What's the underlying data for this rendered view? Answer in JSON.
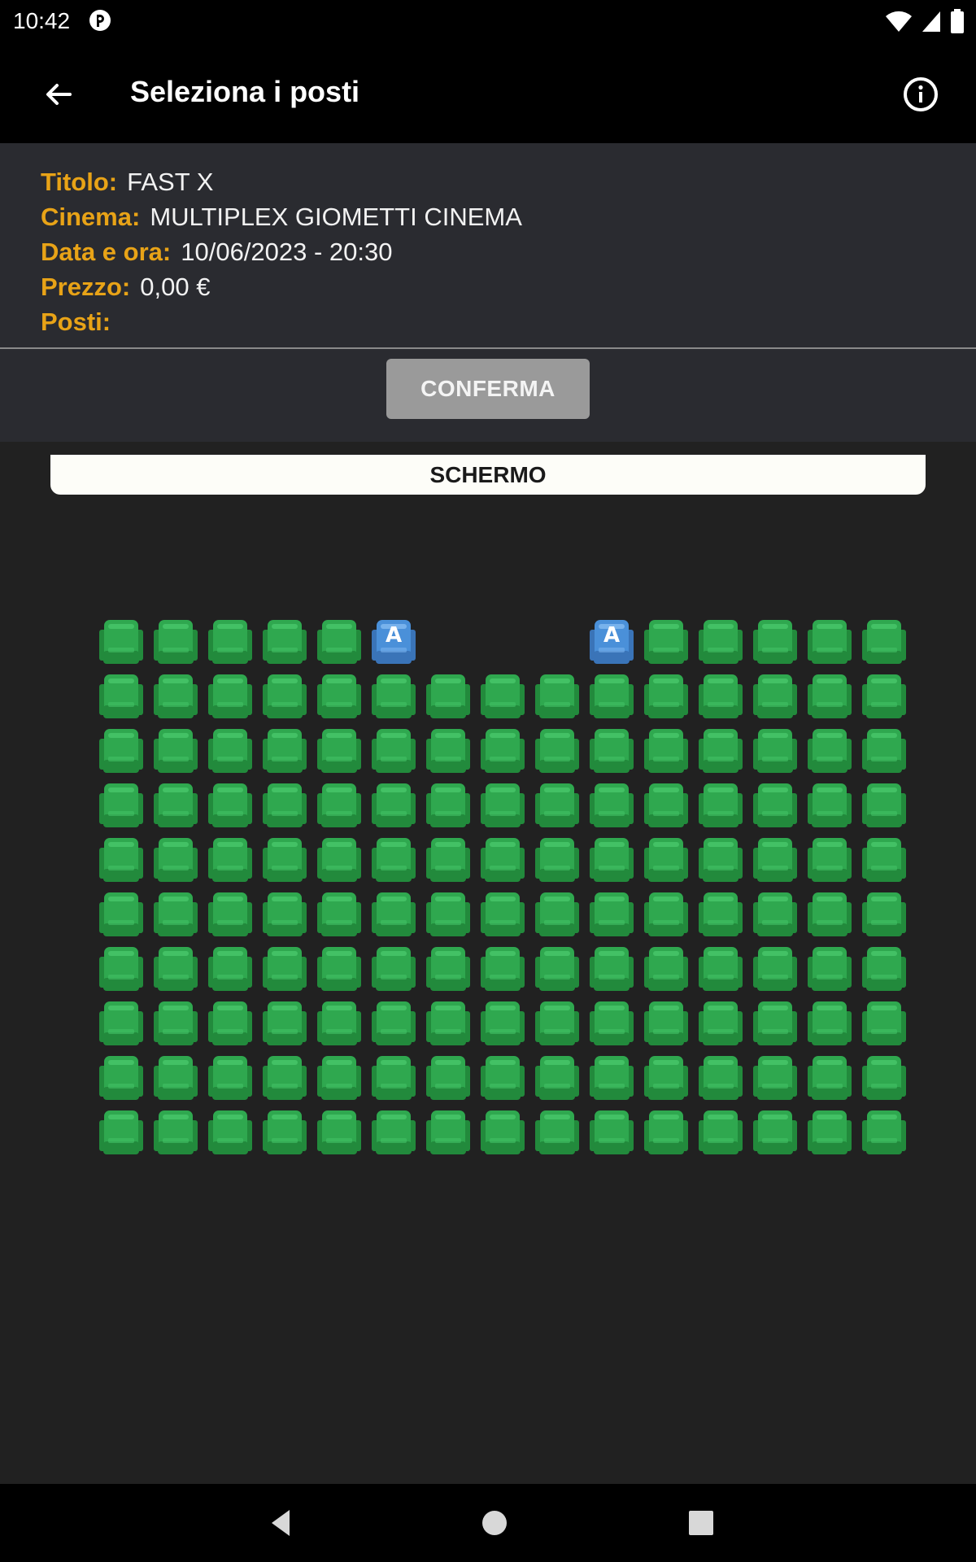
{
  "status_bar": {
    "time": "10:42",
    "icons": [
      "app-notification-icon",
      "wifi-icon",
      "cellular-signal-icon",
      "battery-icon"
    ]
  },
  "app_bar": {
    "title": "Seleziona i posti",
    "back_icon": "arrow-left-icon",
    "info_icon": "info-circle-icon"
  },
  "details": {
    "title_label": "Titolo:",
    "title_value": "FAST X",
    "cinema_label": "Cinema:",
    "cinema_value": "MULTIPLEX GIOMETTI CINEMA",
    "datetime_label": "Data e ora:",
    "datetime_value": "10/06/2023 - 20:30",
    "price_label": "Prezzo:",
    "price_value": "0,00 €",
    "seats_label": "Posti:",
    "seats_value": ""
  },
  "confirm_button": "CONFERMA",
  "screen_label": "SCHERMO",
  "seat_map": {
    "columns": 15,
    "rows": [
      "AAAAAB...BAAAAA",
      "AAAAAAAAAAAAAAA",
      "AAAAAAAAAAAAAAA",
      "AAAAAAAAAAAAAAA",
      "AAAAAAAAAAAAAAA",
      "AAAAAAAAAAAAAAA",
      "AAAAAAAAAAAAAAA",
      "AAAAAAAAAAAAAAA",
      "AAAAAAAAAAAAAAA",
      "AAAAAAAAAAAAAAA"
    ],
    "legend": {
      "A": "available-seat",
      "B": "accessible-seat",
      ".": "empty"
    },
    "accessible_seat_label": "A"
  },
  "colors": {
    "accent": "#e8a317",
    "seat_available": "#2fa84f",
    "seat_accessible": "#4a90d9",
    "confirm_disabled": "#9a9a9a"
  },
  "nav_bar": {
    "icons": [
      "nav-back-icon",
      "nav-home-icon",
      "nav-recents-icon"
    ]
  }
}
